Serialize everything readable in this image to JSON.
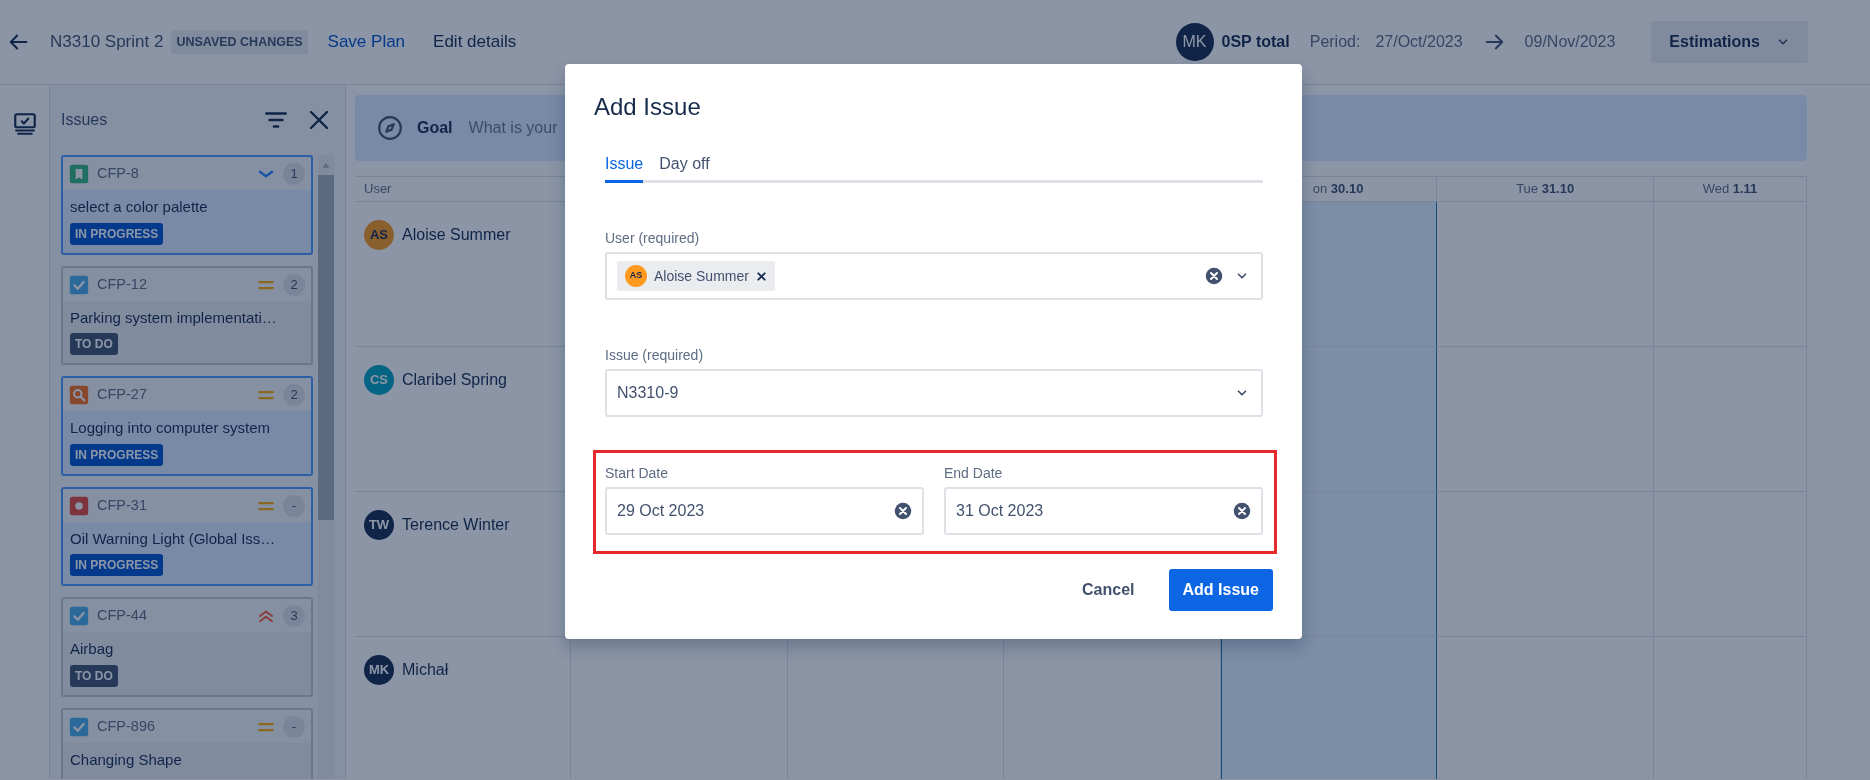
{
  "topbar": {
    "title": "N3310 Sprint 2",
    "unsaved_badge": "UNSAVED CHANGES",
    "save_link": "Save Plan",
    "edit_link": "Edit details",
    "avatar": {
      "initials": "MK",
      "color": "#102548"
    },
    "total": "0SP total",
    "period_label": "Period:",
    "period_start": "27/Oct/2023",
    "period_end": "09/Nov/2023",
    "estimations_button": "Estimations"
  },
  "issues_panel": {
    "title": "Issues",
    "cards": [
      {
        "key": "CFP-8",
        "type_icon": {
          "kind": "story"
        },
        "priority_icon": {
          "kind": "low"
        },
        "estimate": "1",
        "title": "select a color palette",
        "status": {
          "label": "IN PROGRESS",
          "kind": "inprogress"
        },
        "selected": true
      },
      {
        "key": "CFP-12",
        "type_icon": {
          "kind": "task"
        },
        "priority_icon": {
          "kind": "medium"
        },
        "estimate": "2",
        "title": "Parking system implementati…",
        "status": {
          "label": "TO DO",
          "kind": "todo"
        },
        "selected": false
      },
      {
        "key": "CFP-27",
        "type_icon": {
          "kind": "research"
        },
        "priority_icon": {
          "kind": "medium"
        },
        "estimate": "2",
        "title": "Logging into computer system",
        "status": {
          "label": "IN PROGRESS",
          "kind": "inprogress"
        },
        "selected": true
      },
      {
        "key": "CFP-31",
        "type_icon": {
          "kind": "bug"
        },
        "priority_icon": {
          "kind": "medium"
        },
        "estimate": "-",
        "title": "Oil Warning Light (Global Iss…",
        "status": {
          "label": "IN PROGRESS",
          "kind": "inprogress"
        },
        "selected": true
      },
      {
        "key": "CFP-44",
        "type_icon": {
          "kind": "task"
        },
        "priority_icon": {
          "kind": "highest"
        },
        "estimate": "3",
        "title": "Airbag",
        "status": {
          "label": "TO DO",
          "kind": "todo"
        },
        "selected": false
      },
      {
        "key": "CFP-896",
        "type_icon": {
          "kind": "task"
        },
        "priority_icon": {
          "kind": "medium"
        },
        "estimate": "-",
        "title": "Changing Shape",
        "selected": false
      }
    ]
  },
  "goal": {
    "label": "Goal",
    "placeholder": "What is your"
  },
  "board": {
    "user_column": "User",
    "days": [
      {
        "day": "on",
        "date": "30.10",
        "today": true
      },
      {
        "day": "Tue",
        "date": "31.10",
        "today": false
      },
      {
        "day": "Wed",
        "date": "1.11",
        "today": false
      }
    ],
    "users": [
      {
        "initials": "AS",
        "name": "Aloise Summer",
        "color": "#8b5f2f"
      },
      {
        "initials": "CS",
        "name": "Claribel Spring",
        "color": "#046484"
      },
      {
        "initials": "TW",
        "name": "Terence Winter",
        "color": "#102548"
      },
      {
        "initials": "MK",
        "name": "Michał",
        "color": "#102548"
      }
    ]
  },
  "modal": {
    "title": "Add Issue",
    "tabs": [
      {
        "label": "Issue",
        "selected": true
      },
      {
        "label": "Day off",
        "selected": false
      }
    ],
    "user_field": {
      "label": "User (required)",
      "chips": [
        {
          "initials": "AS",
          "name": "Aloise Summer",
          "color": "#ff991f"
        }
      ]
    },
    "issue_field": {
      "label": "Issue (required)",
      "value": "N3310-9"
    },
    "dates_highlighted": true,
    "start_date": {
      "label": "Start Date",
      "value": "29 Oct 2023"
    },
    "end_date": {
      "label": "End Date",
      "value": "31 Oct 2023"
    },
    "buttons": [
      {
        "label": "Cancel",
        "kind": "subtle"
      },
      {
        "label": "Add Issue",
        "kind": "primary"
      }
    ]
  }
}
